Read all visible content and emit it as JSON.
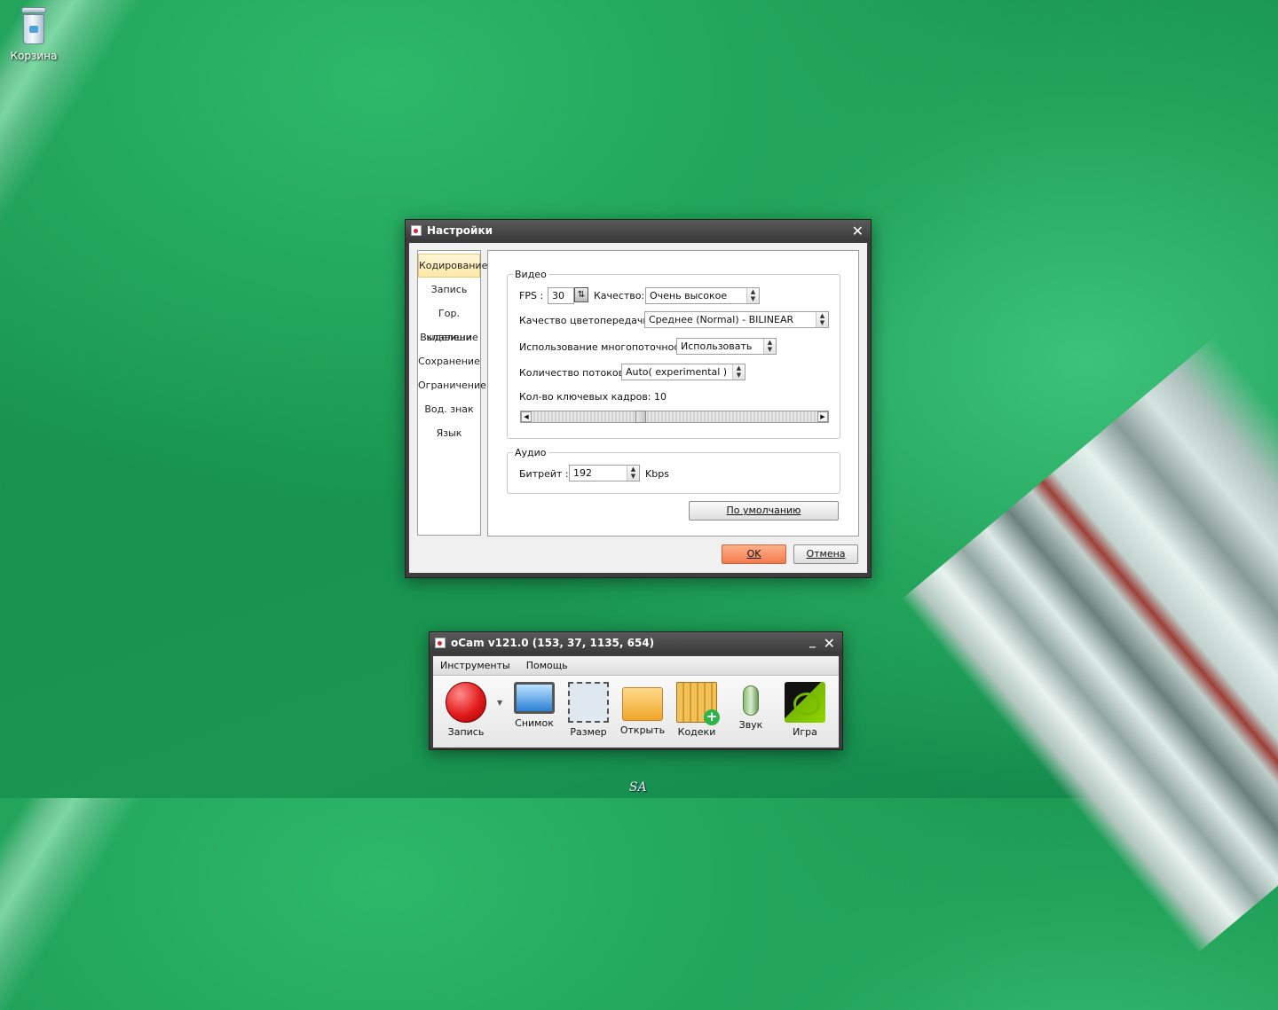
{
  "desktop": {
    "recycle_bin_label": "Корзина",
    "signature": "SA"
  },
  "settings": {
    "title": "Настройки",
    "sidebar": [
      "Кодирование",
      "Запись",
      "Гор. клавиши",
      "Выделение",
      "Сохранение",
      "Ограничение",
      "Вод. знак",
      "Язык"
    ],
    "video": {
      "legend": "Видео",
      "fps_label": "FPS :",
      "fps_value": "30",
      "quality_label": "Качество:",
      "quality_value": "Очень высокое",
      "color_label": "Качество цветопередачи:",
      "color_value": "Среднее (Normal) - BILINEAR",
      "mt_label": "Использование многопоточности:",
      "mt_value": "Использовать",
      "threads_label": "Количество потоков:",
      "threads_value": "Auto( experimental )",
      "keyframes_label": "Кол-во ключевых кадров:",
      "keyframes_value": "10"
    },
    "audio": {
      "legend": "Аудио",
      "bitrate_label": "Битрейт :",
      "bitrate_value": "192",
      "bitrate_unit": "Kbps"
    },
    "default_button": "По умолчанию",
    "ok_button": "OK",
    "cancel_button": "Отмена"
  },
  "ocam": {
    "title": "oCam v121.0 (153, 37, 1135, 654)",
    "menu": [
      "Инструменты",
      "Помощь"
    ],
    "tools": [
      "Запись",
      "Снимок",
      "Размер",
      "Открыть",
      "Кодеки",
      "Звук",
      "Игра"
    ]
  }
}
